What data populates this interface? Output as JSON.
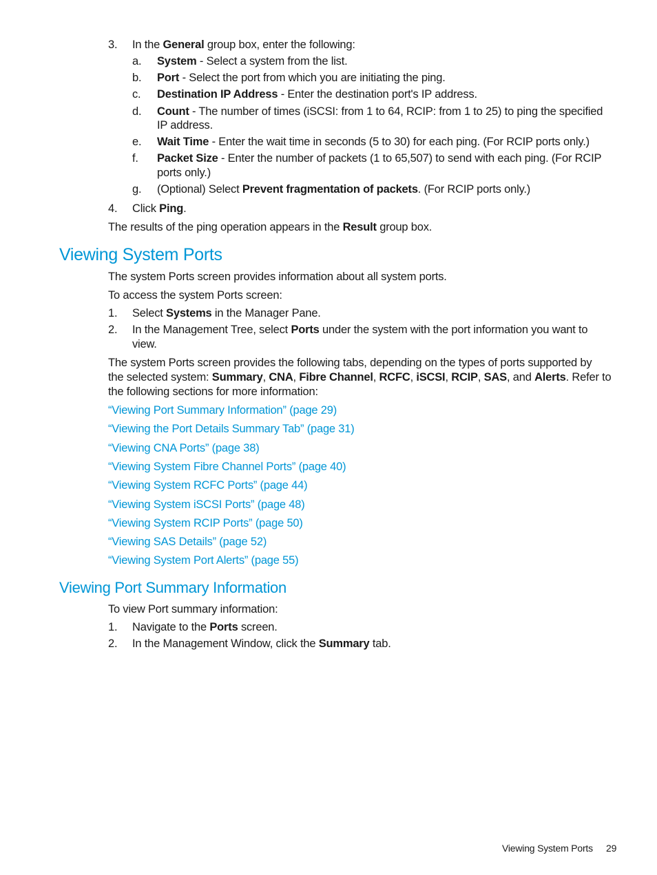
{
  "step3": {
    "num": "3.",
    "pre": "In the ",
    "bold": "General",
    "post": " group box, enter the following:",
    "substeps": [
      {
        "letter": "a.",
        "bold": "System",
        "text": " - Select a system from the list."
      },
      {
        "letter": "b.",
        "bold": "Port",
        "text": " - Select the port from which you are initiating the ping."
      },
      {
        "letter": "c.",
        "bold": "Destination IP Address",
        "text": " - Enter the destination port's IP address."
      },
      {
        "letter": "d.",
        "bold": "Count",
        "text": " - The number of times (iSCSI: from 1 to 64, RCIP: from 1 to 25) to ping the specified",
        "cont": "IP address."
      },
      {
        "letter": "e.",
        "bold": "Wait Time",
        "text": " - Enter the wait time in seconds (5 to 30) for each ping. (For RCIP ports only.)"
      },
      {
        "letter": "f.",
        "bold": "Packet Size",
        "text": " - Enter the number of packets (1 to 65,507) to send with each ping. (For RCIP",
        "cont": "ports only.)"
      },
      {
        "letter": "g.",
        "pre": "(Optional) Select ",
        "bold": "Prevent fragmentation of packets",
        "text": ". (For RCIP ports only.)"
      }
    ]
  },
  "step4": {
    "num": "4.",
    "pre": "Click ",
    "bold": "Ping",
    "post": "."
  },
  "result_note": {
    "pre": "The results of the ping operation appears in the ",
    "bold": "Result",
    "post": " group box."
  },
  "section1": {
    "title": "Viewing System Ports",
    "intro": "The system Ports screen provides information about all system ports.",
    "access": "To access the system Ports screen:",
    "steps": [
      {
        "num": "1.",
        "pre": "Select ",
        "bold": "Systems",
        "post": " in the Manager Pane."
      },
      {
        "num": "2.",
        "pre": "In the Management Tree, select ",
        "bold": "Ports",
        "post": " under the system with the port information you want to",
        "cont": "view."
      }
    ],
    "tabs_para": {
      "line1": "The system Ports screen provides the following tabs, depending on the types of ports supported by",
      "line2_pre": "the selected system: ",
      "tabs": [
        "Summary",
        "CNA",
        "Fibre Channel",
        "RCFC",
        "iSCSI",
        "RCIP",
        "SAS",
        "Alerts"
      ],
      "line2_post": ". Refer to",
      "line3": "the following sections for more information:"
    },
    "links": [
      "“Viewing Port Summary Information” (page 29)",
      "“Viewing the Port Details Summary Tab” (page 31)",
      "“Viewing CNA Ports” (page 38)",
      "“Viewing System Fibre Channel Ports” (page 40)",
      "“Viewing System RCFC Ports” (page 44)",
      "“Viewing System iSCSI Ports” (page 48)",
      "“Viewing System RCIP Ports” (page 50)",
      "“Viewing SAS Details” (page 52)",
      "“Viewing System Port Alerts” (page 55)"
    ]
  },
  "section2": {
    "title": "Viewing Port Summary Information",
    "intro": "To view Port summary information:",
    "steps": [
      {
        "num": "1.",
        "pre": "Navigate to the ",
        "bold": "Ports",
        "post": " screen."
      },
      {
        "num": "2.",
        "pre": "In the Management Window, click the ",
        "bold": "Summary",
        "post": " tab."
      }
    ]
  },
  "footer": {
    "section": "Viewing System Ports",
    "page": "29"
  },
  "colors": {
    "heading": "#0096d6",
    "link": "#0096d6",
    "text": "#1a1a1a"
  }
}
